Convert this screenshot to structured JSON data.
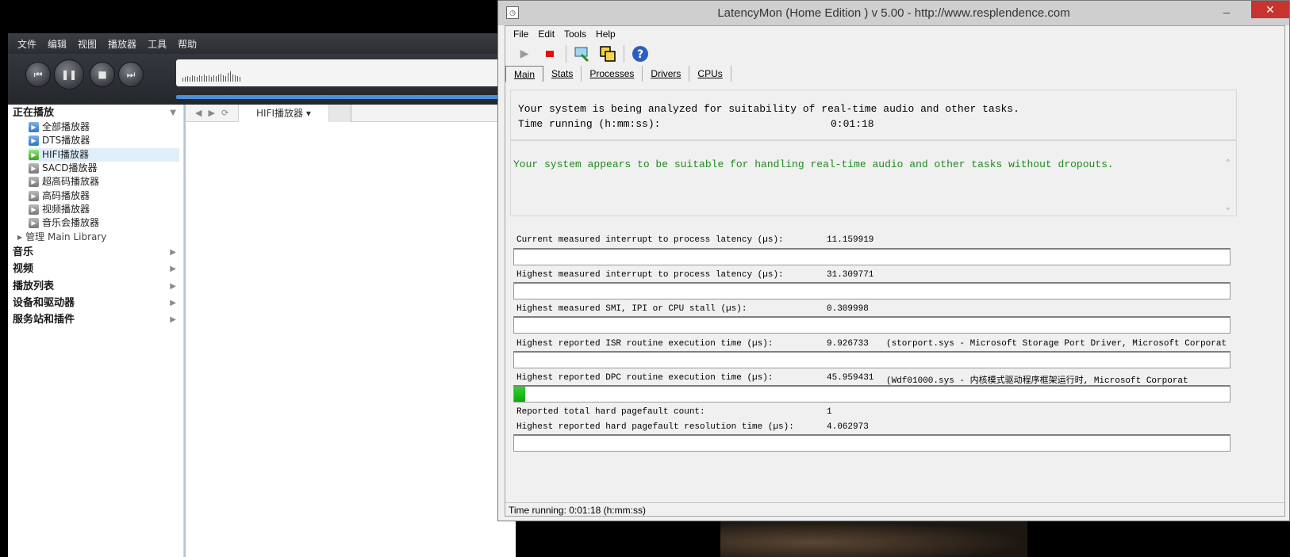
{
  "player": {
    "menu": [
      "文件",
      "编辑",
      "视图",
      "播放器",
      "工具",
      "帮助"
    ],
    "controls": {
      "prev": "⏮",
      "pause": "❚❚",
      "stop": "■",
      "next": "⏭"
    },
    "tab_label": "HIFI播放器 ▾",
    "nav_icons": [
      "◀",
      "▶",
      "⟳"
    ],
    "sidebar": {
      "now_playing": "正在播放",
      "players": [
        {
          "label": "全部播放器",
          "icon": "blue"
        },
        {
          "label": "DTS播放器",
          "icon": "blue"
        },
        {
          "label": "HIFI播放器",
          "icon": "green",
          "selected": true
        },
        {
          "label": "SACD播放器",
          "icon": "gray"
        },
        {
          "label": "超高码播放器",
          "icon": "gray"
        },
        {
          "label": "高码播放器",
          "icon": "gray"
        },
        {
          "label": "视频播放器",
          "icon": "gray"
        },
        {
          "label": "音乐会播放器",
          "icon": "gray"
        }
      ],
      "library": "管理 Main Library",
      "sections": [
        "音乐",
        "视频",
        "播放列表",
        "设备和驱动器",
        "服务站和插件"
      ]
    }
  },
  "latencymon": {
    "title": "LatencyMon  (Home Edition )  v 5.00 - http://www.resplendence.com",
    "menu": [
      "File",
      "Edit",
      "Tools",
      "Help"
    ],
    "tabs": [
      "Main",
      "Stats",
      "Processes",
      "Drivers",
      "CPUs"
    ],
    "active_tab": "Main",
    "analysis_line": "Your system is being analyzed for suitability of real-time audio and other tasks.",
    "time_label": "Time running (h:mm:ss):",
    "time_value": "0:01:18",
    "verdict": "Your system appears to be suitable for handling real-time audio and other tasks without dropouts.",
    "verdict_color": "#1e8a1e",
    "metrics": [
      {
        "label": "Current measured interrupt to process latency (µs):",
        "value": "11.159919",
        "extra": "",
        "bar": 0
      },
      {
        "label": "Highest measured interrupt to process latency (µs):",
        "value": "31.309771",
        "extra": "",
        "bar": 0
      },
      {
        "label": "Highest measured SMI, IPI or CPU stall (µs):",
        "value": "0.309998",
        "extra": "",
        "bar": 0
      },
      {
        "label": "Highest reported ISR routine execution time (µs):",
        "value": "9.926733",
        "extra": "(storport.sys - Microsoft Storage Port Driver, Microsoft Corporat",
        "bar": 0
      },
      {
        "label": "Highest reported DPC routine execution time (µs):",
        "value": "45.959431",
        "extra": "(Wdf01000.sys - 内核模式驱动程序框架运行时, Microsoft Corporat",
        "bar": 0.015
      }
    ],
    "pagefault_count_label": "Reported total hard pagefault count:",
    "pagefault_count_value": "1",
    "pagefault_time_label": "Highest reported hard pagefault resolution time (µs):",
    "pagefault_time_value": "4.062973",
    "pagefault_bar": 0,
    "status": "Time running: 0:01:18  (h:mm:ss)"
  }
}
